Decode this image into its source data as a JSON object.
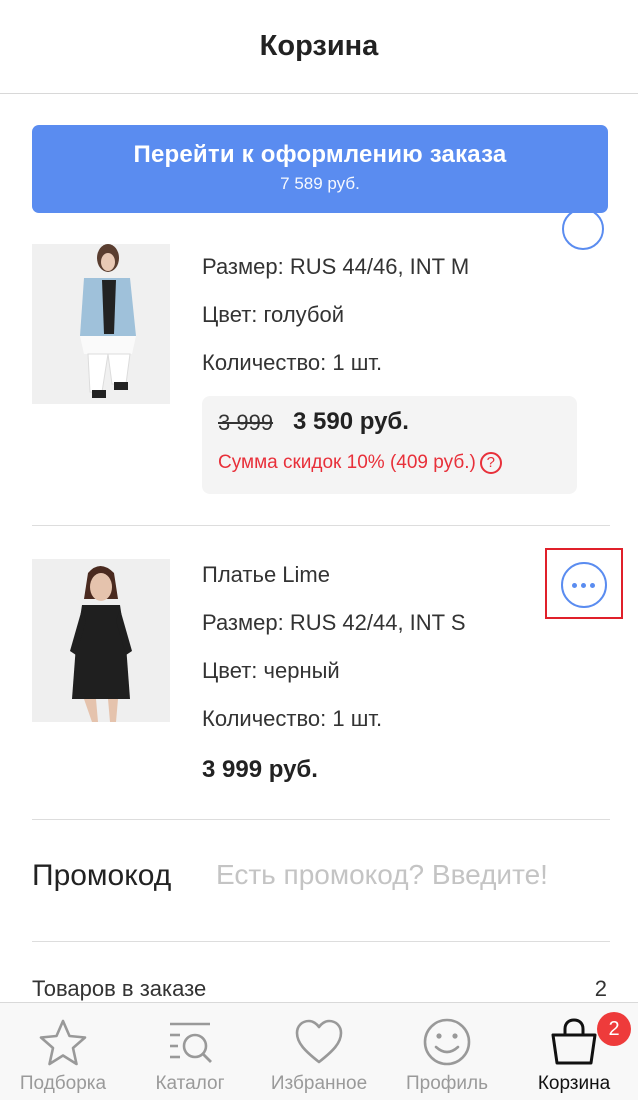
{
  "header": {
    "title": "Корзина"
  },
  "checkout": {
    "label": "Перейти к оформлению заказа",
    "total": "7 589 руб."
  },
  "products": [
    {
      "size": "Размер: RUS 44/46, INT M",
      "color": "Цвет: голубой",
      "quantity": "Количество: 1 шт.",
      "old_price": "3 999",
      "price": "3 590 руб.",
      "discount": "Сумма скидок 10% (409 руб.)",
      "discount_icon": "?"
    },
    {
      "name": "Платье Lime",
      "size": "Размер: RUS 42/44, INT S",
      "color": "Цвет: черный",
      "quantity": "Количество: 1 шт.",
      "price": "3 999 руб."
    }
  ],
  "promo": {
    "label": "Промокод",
    "placeholder": "Есть промокод? Введите!",
    "value": ""
  },
  "summary": {
    "items_label": "Товаров в заказе",
    "items_count": "2"
  },
  "tabbar": {
    "tabs": [
      {
        "label": "Подборка",
        "icon": "star-icon"
      },
      {
        "label": "Каталог",
        "icon": "catalog-search-icon"
      },
      {
        "label": "Избранное",
        "icon": "heart-icon"
      },
      {
        "label": "Профиль",
        "icon": "smiley-icon"
      },
      {
        "label": "Корзина",
        "icon": "bag-icon",
        "active": true,
        "badge": "2"
      }
    ]
  },
  "colors": {
    "accent": "#5a8cf0",
    "discount": "#e8303a",
    "badge": "#ee3b3b",
    "highlight": "#e0202a"
  }
}
